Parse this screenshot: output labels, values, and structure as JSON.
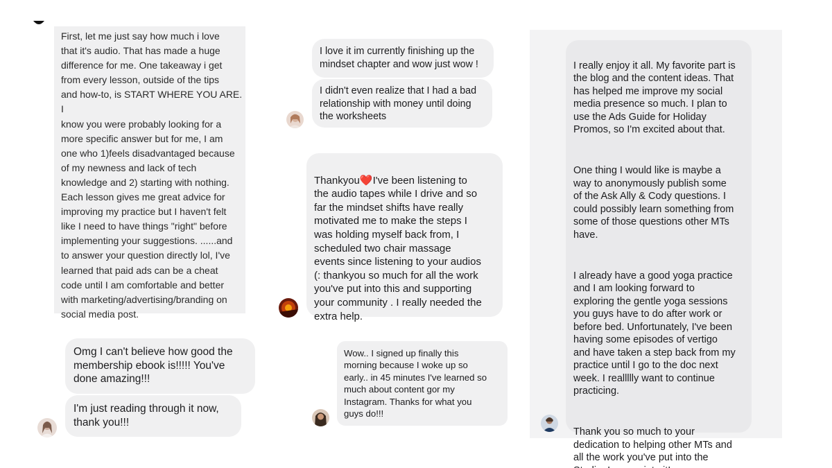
{
  "left_column": {
    "long_message": "First, let me just say how much i love\nthat it's audio. That has made a huge\ndifference for me. One takeaway i get\nfrom every lesson, outside of the tips\nand how-to, is START WHERE YOU ARE. I\nknow you were probably looking for a\nmore specific answer but for me, I am\none who 1)feels disadvantaged because\nof my newness and lack of tech\nknowledge and 2) starting with nothing.\nEach lesson gives me great advice for\nimproving my practice but I haven't felt\nlike I need to have things \"right\" before\nimplementing your suggestions. ......and\nto answer your question directly lol, I've\nlearned that paid ads can be a cheat\ncode until I am comfortable and better\nwith marketing/advertising/branding on\nsocial media post.",
    "bubble_1": "Omg I can't believe how good the\nmembership ebook is!!!!! You've\ndone amazing!!!",
    "bubble_2": "I'm just reading through it now,\nthank you!!!"
  },
  "middle_column": {
    "bubble_1": "I love it im currently finishing up the\nmindset chapter and wow just wow !",
    "bubble_2": "I didn't even realize that I had a bad\nrelationship with money until doing\nthe worksheets",
    "bubble_3_prefix": "Thankyou",
    "bubble_3_body": "I've been listening to\nthe audio tapes while I drive and so\nfar the mindset shifts have really\nmotivated me to make the steps I\nwas holding myself back from, I\nscheduled two chair massage\nevents since listening to your audios\n(: thankyou so much for all the work\nyou've put into this and supporting\nyour community . I really needed the\nextra help.",
    "heart_emoji": "❤️",
    "bubble_4": "Wow.. I signed up finally this\nmorning because I woke up so\nearly.. in 45 minutes I've learned so\nmuch about content gor my\nInstagram. Thanks for what you\nguys do!!!"
  },
  "right_column": {
    "paragraph_1": "I really enjoy it all. My favorite part is\nthe blog and the content ideas. That\nhas helped me improve my social\nmedia presence so much. I plan to\nuse the Ads Guide for Holiday\nPromos, so I'm excited about that.",
    "paragraph_2": "One thing I would like is maybe a\nway to anonymously publish some\nof the Ask Ally & Cody questions. I\ncould possibly learn something from\nsome of those questions other MTs\nhave.",
    "paragraph_3": "I already have a good yoga practice\nand I am looking forward to\nexploring the gentle yoga sessions\nyou guys have to do after work or\nbefore bed. Unfortunately, I've been\nhaving some episodes of vertigo\nand have taken a step back from my\npractice until I go to the doc next\nweek. I reallllly want to continue\npracticing.",
    "paragraph_4": "Thank you so much to your\ndedication to helping other MTs and\nall the work you've put into the\nStudio. I appreciate it!"
  },
  "colors": {
    "bubble_bg": "#f0f0f1",
    "panel_bg": "#f3f3f4",
    "text": "#1c1c1e",
    "heart": "#e0232e"
  }
}
